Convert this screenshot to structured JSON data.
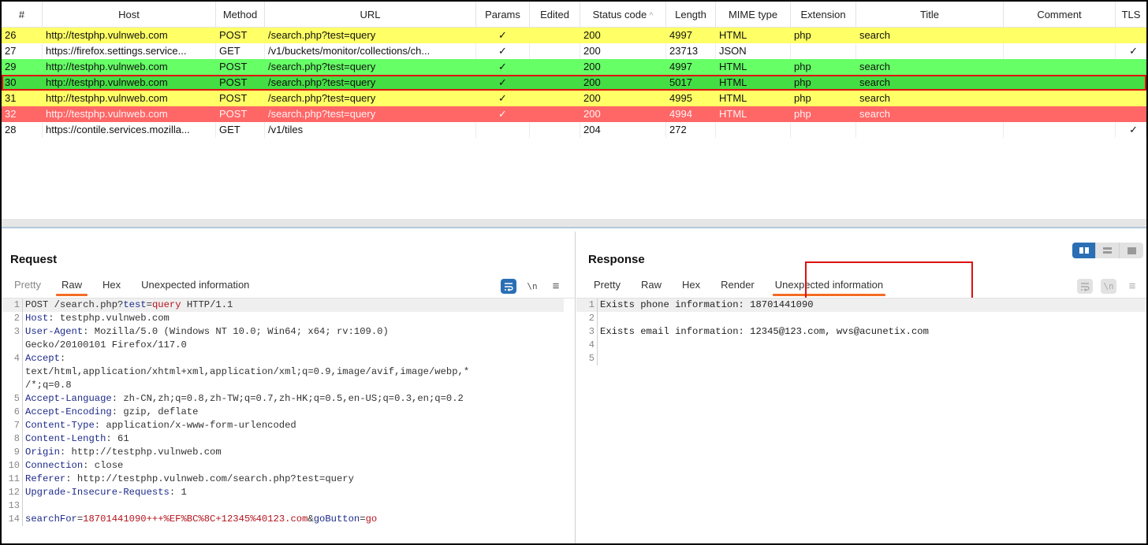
{
  "table": {
    "columns": [
      "#",
      "Host",
      "Method",
      "URL",
      "Params",
      "Edited",
      "Status code",
      "Length",
      "MIME type",
      "Extension",
      "Title",
      "Comment",
      "TLS"
    ],
    "sort_indicator": "^",
    "rows": [
      {
        "id": "26",
        "host": "http://testphp.vulnweb.com",
        "method": "POST",
        "url": "/search.php?test=query",
        "params": "✓",
        "edited": "",
        "status": "200",
        "length": "4997",
        "mime": "HTML",
        "ext": "php",
        "title": "search",
        "comment": "",
        "tls": "",
        "highlight": "yellow",
        "selected": false
      },
      {
        "id": "27",
        "host": "https://firefox.settings.service...",
        "method": "GET",
        "url": "/v1/buckets/monitor/collections/ch...",
        "params": "✓",
        "edited": "",
        "status": "200",
        "length": "23713",
        "mime": "JSON",
        "ext": "",
        "title": "",
        "comment": "",
        "tls": "✓",
        "highlight": "none",
        "selected": false
      },
      {
        "id": "29",
        "host": "http://testphp.vulnweb.com",
        "method": "POST",
        "url": "/search.php?test=query",
        "params": "✓",
        "edited": "",
        "status": "200",
        "length": "4997",
        "mime": "HTML",
        "ext": "php",
        "title": "search",
        "comment": "",
        "tls": "",
        "highlight": "green",
        "selected": false
      },
      {
        "id": "30",
        "host": "http://testphp.vulnweb.com",
        "method": "POST",
        "url": "/search.php?test=query",
        "params": "✓",
        "edited": "",
        "status": "200",
        "length": "5017",
        "mime": "HTML",
        "ext": "php",
        "title": "search",
        "comment": "",
        "tls": "",
        "highlight": "green",
        "selected": true
      },
      {
        "id": "31",
        "host": "http://testphp.vulnweb.com",
        "method": "POST",
        "url": "/search.php?test=query",
        "params": "✓",
        "edited": "",
        "status": "200",
        "length": "4995",
        "mime": "HTML",
        "ext": "php",
        "title": "search",
        "comment": "",
        "tls": "",
        "highlight": "yellow",
        "selected": false
      },
      {
        "id": "32",
        "host": "http://testphp.vulnweb.com",
        "method": "POST",
        "url": "/search.php?test=query",
        "params": "✓",
        "edited": "",
        "status": "200",
        "length": "4994",
        "mime": "HTML",
        "ext": "php",
        "title": "search",
        "comment": "",
        "tls": "",
        "highlight": "red",
        "selected": false
      },
      {
        "id": "28",
        "host": "https://contile.services.mozilla...",
        "method": "GET",
        "url": "/v1/tiles",
        "params": "",
        "edited": "",
        "status": "204",
        "length": "272",
        "mime": "",
        "ext": "",
        "title": "",
        "comment": "",
        "tls": "✓",
        "highlight": "none",
        "selected": false
      }
    ]
  },
  "request": {
    "title": "Request",
    "tabs": [
      "Pretty",
      "Raw",
      "Hex",
      "Unexpected information"
    ],
    "active_tab": "Raw",
    "icons": {
      "wrap": "word-wrap-icon",
      "newline": "\\n",
      "menu": "≡"
    },
    "lines": [
      {
        "n": "1",
        "parts": [
          [
            "t",
            "POST /search.php?"
          ],
          [
            "pk",
            "test"
          ],
          [
            "t",
            "="
          ],
          [
            "pv",
            "query"
          ],
          [
            "t",
            " HTTP/1.1"
          ]
        ]
      },
      {
        "n": "2",
        "parts": [
          [
            "hk",
            "Host"
          ],
          [
            "t",
            ": testphp.vulnweb.com"
          ]
        ]
      },
      {
        "n": "3",
        "parts": [
          [
            "hk",
            "User-Agent"
          ],
          [
            "t",
            ": Mozilla/5.0 (Windows NT 10.0; Win64; x64; rv:109.0)"
          ]
        ]
      },
      {
        "n": "",
        "parts": [
          [
            "t",
            "Gecko/20100101 Firefox/117.0"
          ]
        ]
      },
      {
        "n": "4",
        "parts": [
          [
            "hk",
            "Accept"
          ],
          [
            "t",
            ":"
          ]
        ]
      },
      {
        "n": "",
        "parts": [
          [
            "t",
            "text/html,application/xhtml+xml,application/xml;q=0.9,image/avif,image/webp,*"
          ]
        ]
      },
      {
        "n": "",
        "parts": [
          [
            "t",
            "/*;q=0.8"
          ]
        ]
      },
      {
        "n": "5",
        "parts": [
          [
            "hk",
            "Accept-Language"
          ],
          [
            "t",
            ": zh-CN,zh;q=0.8,zh-TW;q=0.7,zh-HK;q=0.5,en-US;q=0.3,en;q=0.2"
          ]
        ]
      },
      {
        "n": "6",
        "parts": [
          [
            "hk",
            "Accept-Encoding"
          ],
          [
            "t",
            ": gzip, deflate"
          ]
        ]
      },
      {
        "n": "7",
        "parts": [
          [
            "hk",
            "Content-Type"
          ],
          [
            "t",
            ": application/x-www-form-urlencoded"
          ]
        ]
      },
      {
        "n": "8",
        "parts": [
          [
            "hk",
            "Content-Length"
          ],
          [
            "t",
            ": 61"
          ]
        ]
      },
      {
        "n": "9",
        "parts": [
          [
            "hk",
            "Origin"
          ],
          [
            "t",
            ": http://testphp.vulnweb.com"
          ]
        ]
      },
      {
        "n": "10",
        "parts": [
          [
            "hk",
            "Connection"
          ],
          [
            "t",
            ": close"
          ]
        ]
      },
      {
        "n": "11",
        "parts": [
          [
            "hk",
            "Referer"
          ],
          [
            "t",
            ": http://testphp.vulnweb.com/search.php?test=query"
          ]
        ]
      },
      {
        "n": "12",
        "parts": [
          [
            "hk",
            "Upgrade-Insecure-Requests"
          ],
          [
            "t",
            ": 1"
          ]
        ]
      },
      {
        "n": "13",
        "parts": []
      },
      {
        "n": "14",
        "parts": [
          [
            "pk",
            "searchFor"
          ],
          [
            "t",
            "="
          ],
          [
            "pv",
            "18701441090+++%EF%BC%8C+12345%40123.com"
          ],
          [
            "t",
            "&"
          ],
          [
            "pk",
            "goButton"
          ],
          [
            "t",
            "="
          ],
          [
            "pv",
            "go"
          ]
        ]
      }
    ]
  },
  "response": {
    "title": "Response",
    "tabs": [
      "Pretty",
      "Raw",
      "Hex",
      "Render",
      "Unexpected information"
    ],
    "active_tab": "Unexpected information",
    "icons": {
      "wrap": "word-wrap-icon",
      "newline": "\\n",
      "menu": "≡"
    },
    "view_modes": [
      "split-view",
      "horizontal-view",
      "single-view"
    ],
    "active_view": "split-view",
    "lines": [
      {
        "n": "1",
        "text": "Exists phone information: 18701441090"
      },
      {
        "n": "2",
        "text": ""
      },
      {
        "n": "3",
        "text": "Exists email information: 12345@123.com, wvs@acunetix.com"
      },
      {
        "n": "4",
        "text": ""
      },
      {
        "n": "5",
        "text": ""
      }
    ]
  },
  "colors": {
    "row_yellow": "#ffff66",
    "row_green": "#66ff66",
    "row_selected_green": "#44dd44",
    "row_red": "#ff6666",
    "selection_outline": "#dd1111",
    "tab_underline": "#f36c24",
    "accent_blue": "#2a6fb5"
  }
}
